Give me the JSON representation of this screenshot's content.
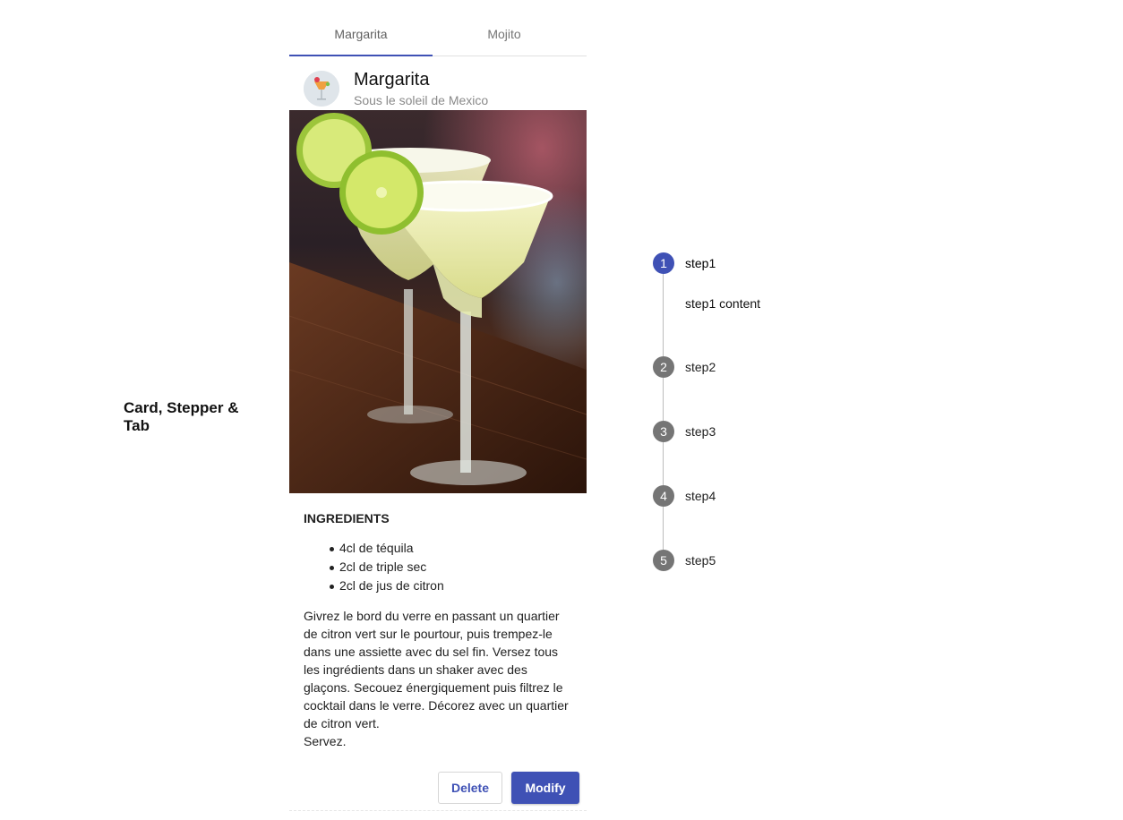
{
  "section": {
    "title": "Card, Stepper & Tab"
  },
  "tabs": [
    {
      "label": "Margarita",
      "active": true
    },
    {
      "label": "Mojito",
      "active": false
    }
  ],
  "card": {
    "title": "Margarita",
    "subtitle": "Sous le soleil de Mexico",
    "avatar_icon": "cocktail-avatar-icon",
    "media_alt": "margarita-glasses-photo",
    "ingredients_title": "INGREDIENTS",
    "ingredients": [
      "4cl de téquila",
      "2cl de triple sec",
      "2cl de jus de citron"
    ],
    "instructions": "Givrez le bord du verre en passant un quartier de citron vert sur le pourtour, puis trempez-le dans une assiette avec du sel fin. Versez tous les ingrédients dans un shaker avec des glaçons. Secouez énergiquement puis filtrez le cocktail dans le verre. Décorez avec un quartier de citron vert.\nServez.",
    "actions": {
      "delete_label": "Delete",
      "modify_label": "Modify"
    }
  },
  "stepper": {
    "active_step": 1,
    "steps": [
      {
        "number": "1",
        "label": "step1",
        "content": "step1 content"
      },
      {
        "number": "2",
        "label": "step2"
      },
      {
        "number": "3",
        "label": "step3"
      },
      {
        "number": "4",
        "label": "step4"
      },
      {
        "number": "5",
        "label": "step5"
      }
    ]
  },
  "colors": {
    "primary": "#3f51b5",
    "inactive_step": "#757575",
    "subtitle": "#8a8a8a"
  }
}
